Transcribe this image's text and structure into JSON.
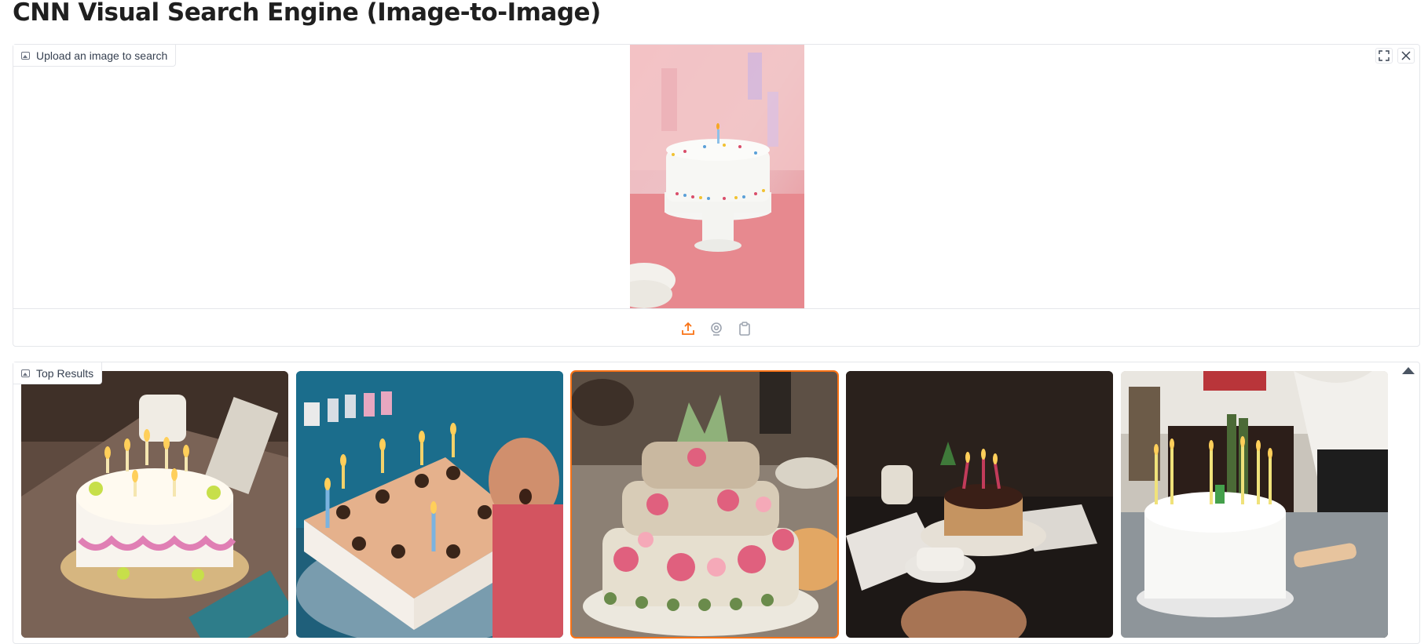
{
  "page": {
    "title": "CNN Visual Search Engine (Image-to-Image)"
  },
  "upload": {
    "label": "Upload an image to search",
    "icon": "image-icon",
    "actions": [
      {
        "name": "fullscreen-icon"
      },
      {
        "name": "close-icon"
      }
    ],
    "sources": [
      {
        "name": "upload-icon",
        "active": true
      },
      {
        "name": "webcam-icon",
        "active": false
      },
      {
        "name": "clipboard-icon",
        "active": false
      }
    ]
  },
  "results": {
    "label": "Top Results",
    "icon": "image-icon",
    "selected_index": 2,
    "items": [
      {
        "name": "result-birthday-cake-1"
      },
      {
        "name": "result-birthday-cake-2"
      },
      {
        "name": "result-birthday-cake-3"
      },
      {
        "name": "result-birthday-cake-4"
      },
      {
        "name": "result-birthday-cake-5"
      }
    ]
  },
  "colors": {
    "accent": "#f97316",
    "border": "#e5e7eb"
  }
}
